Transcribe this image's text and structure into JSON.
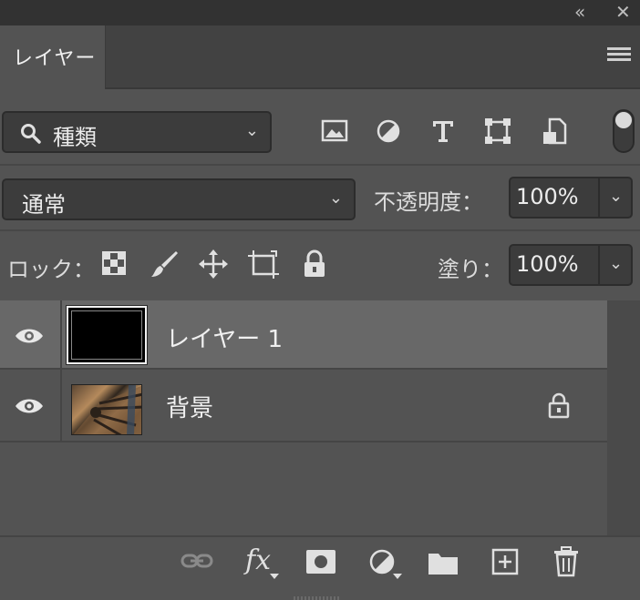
{
  "topbar": {
    "collapse_icon": "«",
    "close_icon": "✕"
  },
  "panel": {
    "tab_label": "レイヤー",
    "menu_icon": "hamburger-menu-icon"
  },
  "filter": {
    "kind_label": "種類",
    "icons": [
      "image-filter-icon",
      "adjustment-filter-icon",
      "type-filter-icon",
      "shape-filter-icon",
      "smart-object-filter-icon"
    ]
  },
  "blend": {
    "mode": "通常",
    "opacity_label": "不透明度：",
    "opacity_value": "100%"
  },
  "lock": {
    "label": "ロック：",
    "fill_label": "塗り：",
    "fill_value": "100%"
  },
  "layers": [
    {
      "name": "レイヤー 1",
      "visible": true,
      "selected": true,
      "locked": false
    },
    {
      "name": "背景",
      "visible": true,
      "selected": false,
      "locked": true
    }
  ],
  "bottom": {
    "fx_label": "fx",
    "icons": [
      "link-layers-icon",
      "fx-icon",
      "layer-mask-icon",
      "adjustment-layer-icon",
      "group-folder-icon",
      "new-layer-icon",
      "trash-icon"
    ]
  },
  "colors": {
    "panel_bg": "#535353",
    "selected_row": "#686868",
    "field_bg": "#3c3c3c"
  }
}
